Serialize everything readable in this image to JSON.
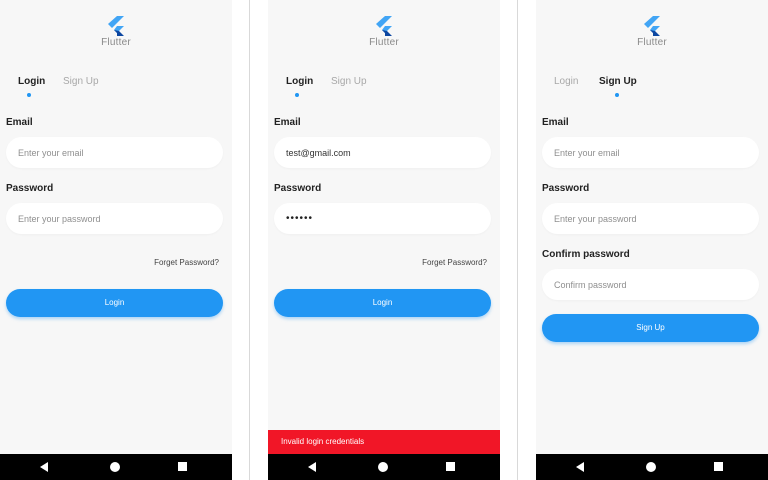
{
  "logo": {
    "text": "Flutter"
  },
  "screens": [
    {
      "tabs": {
        "login": "Login",
        "signup": "Sign Up",
        "active": "login"
      },
      "email": {
        "label": "Email",
        "value": "",
        "placeholder": "Enter your email"
      },
      "password": {
        "label": "Password",
        "value": "",
        "placeholder": "Enter your password"
      },
      "forgot": "Forget Password?",
      "button": "Login"
    },
    {
      "tabs": {
        "login": "Login",
        "signup": "Sign Up",
        "active": "login"
      },
      "email": {
        "label": "Email",
        "value": "test@gmail.com",
        "placeholder": "Enter your email"
      },
      "password": {
        "label": "Password",
        "value": "••••••",
        "placeholder": "Enter your password"
      },
      "forgot": "Forget Password?",
      "button": "Login",
      "snackbar": "Invalid login credentials"
    },
    {
      "tabs": {
        "login": "Login",
        "signup": "Sign Up",
        "active": "signup"
      },
      "email": {
        "label": "Email",
        "value": "",
        "placeholder": "Enter your email"
      },
      "password": {
        "label": "Password",
        "value": "",
        "placeholder": "Enter your password"
      },
      "confirm": {
        "label": "Confirm password",
        "value": "",
        "placeholder": "Confirm password"
      },
      "button": "Sign Up"
    }
  ],
  "colors": {
    "accent": "#2196f3",
    "error": "#f11627",
    "background": "#f7f7f7"
  },
  "icons": {
    "logo": "flutter-logo-icon",
    "back": "back-icon",
    "home": "home-icon",
    "recent": "recent-apps-icon"
  }
}
